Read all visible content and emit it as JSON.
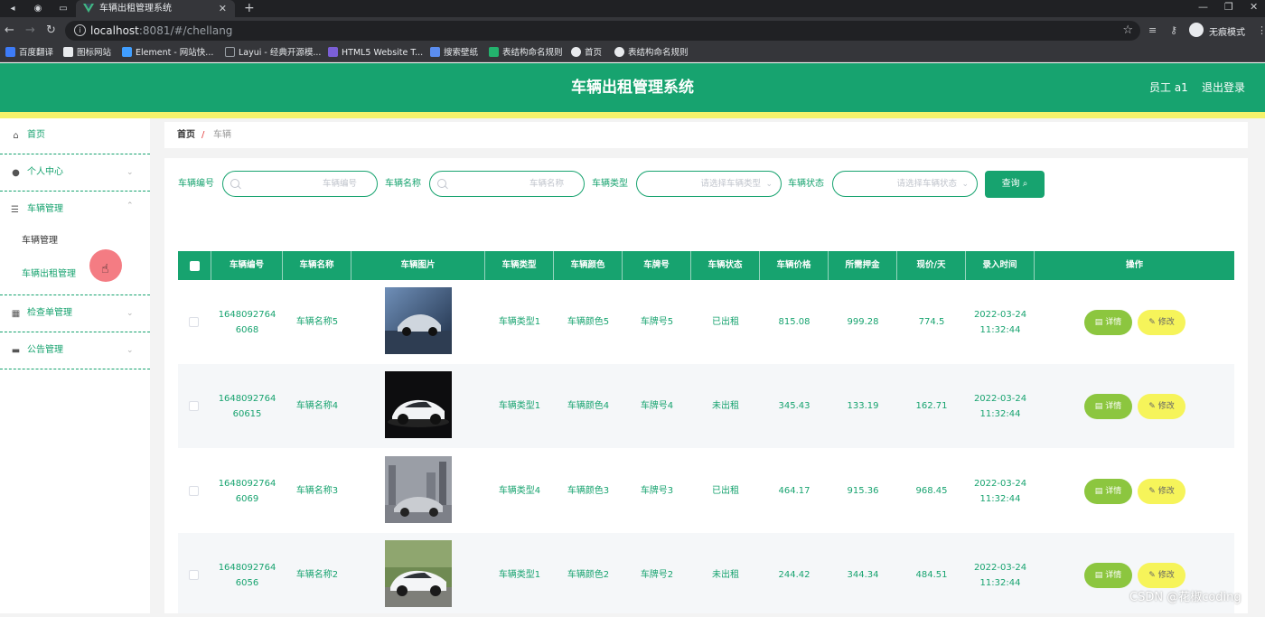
{
  "browser": {
    "tab_title": "车辆出租管理系统",
    "url_host": "localhost",
    "url_rest": ":8081/#/chellang",
    "incognito_label": "无痕模式",
    "bookmarks": [
      "百度翻译",
      "图标网站",
      "Element - 网站快...",
      "Layui - 经典开源模...",
      "HTML5 Website T...",
      "搜索壁纸",
      "表结构命名规则",
      "首页",
      "表结构命名规则"
    ]
  },
  "header": {
    "title": "车辆出租管理系统",
    "user": "员工 a1",
    "logout": "退出登录"
  },
  "sidebar": {
    "items": [
      {
        "label": "首页",
        "icon": "home-icon"
      },
      {
        "label": "个人中心",
        "icon": "user-icon"
      },
      {
        "label": "车辆管理",
        "icon": "list-icon"
      },
      {
        "label": "检查单管理",
        "icon": "grid-icon"
      },
      {
        "label": "公告管理",
        "icon": "ticket-icon"
      }
    ],
    "sub_items": [
      "车辆管理",
      "车辆出租管理"
    ]
  },
  "breadcrumb": {
    "home": "首页",
    "separator": "/",
    "current": "车辆"
  },
  "search": {
    "car_no": {
      "label": "车辆编号",
      "placeholder": "车辆编号"
    },
    "car_name": {
      "label": "车辆名称",
      "placeholder": "车辆名称"
    },
    "car_type": {
      "label": "车辆类型",
      "placeholder": "请选择车辆类型"
    },
    "car_status": {
      "label": "车辆状态",
      "placeholder": "请选择车辆状态"
    },
    "query_button": "查询"
  },
  "table": {
    "columns": [
      "车辆编号",
      "车辆名称",
      "车辆图片",
      "车辆类型",
      "车辆颜色",
      "车牌号",
      "车辆状态",
      "车辆价格",
      "所需押金",
      "现价/天",
      "录入时间",
      "操作"
    ],
    "rows": [
      {
        "id_line1": "1648092764",
        "id_line2": "6068",
        "name": "车辆名称5",
        "type": "车辆类型1",
        "color": "车辆颜色5",
        "plate": "车牌号5",
        "status": "已出租",
        "price": "815.08",
        "deposit": "999.28",
        "daily": "774.5",
        "date": "2022-03-24",
        "time": "11:32:44"
      },
      {
        "id_line1": "1648092764",
        "id_line2": "60615",
        "name": "车辆名称4",
        "type": "车辆类型1",
        "color": "车辆颜色4",
        "plate": "车牌号4",
        "status": "未出租",
        "price": "345.43",
        "deposit": "133.19",
        "daily": "162.71",
        "date": "2022-03-24",
        "time": "11:32:44"
      },
      {
        "id_line1": "1648092764",
        "id_line2": "6069",
        "name": "车辆名称3",
        "type": "车辆类型4",
        "color": "车辆颜色3",
        "plate": "车牌号3",
        "status": "已出租",
        "price": "464.17",
        "deposit": "915.36",
        "daily": "968.45",
        "date": "2022-03-24",
        "time": "11:32:44"
      },
      {
        "id_line1": "1648092764",
        "id_line2": "6056",
        "name": "车辆名称2",
        "type": "车辆类型1",
        "color": "车辆颜色2",
        "plate": "车牌号2",
        "status": "未出租",
        "price": "244.42",
        "deposit": "344.34",
        "daily": "484.51",
        "date": "2022-03-24",
        "time": "11:32:44"
      }
    ],
    "detail_label": "详情",
    "edit_label": "修改"
  },
  "watermark": "CSDN @花椒coding",
  "colors": {
    "primary": "#17a36f",
    "accent": "#f4f26b",
    "detail_button": "#8cc63f",
    "edit_button": "#f6f45a"
  }
}
